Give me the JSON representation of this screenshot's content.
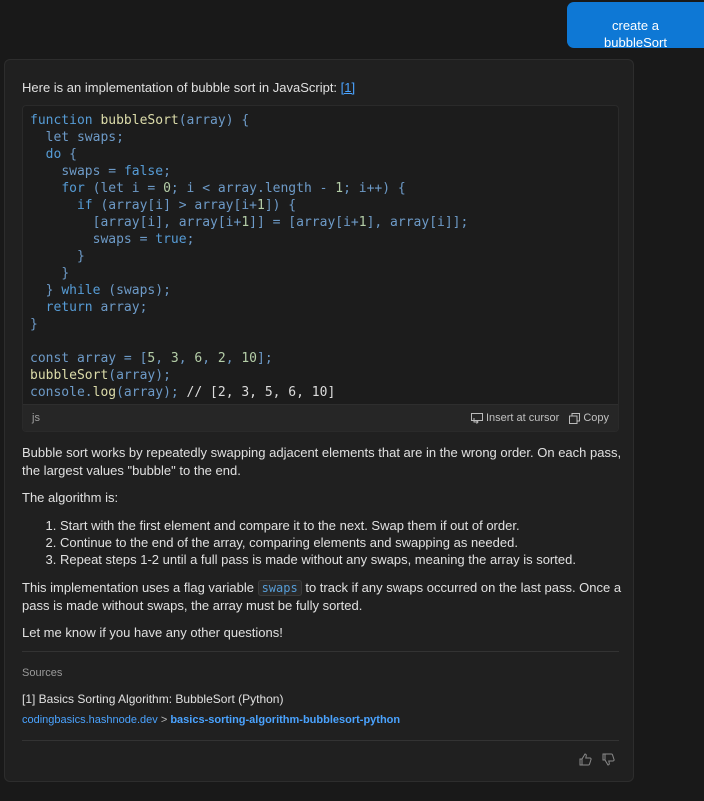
{
  "user_message": "create a bubbleSort",
  "reply": {
    "intro_text": "Here is an implementation of bubble sort in JavaScript:",
    "intro_ref": "[1]",
    "code_language": "js",
    "insert_label": "Insert at cursor",
    "copy_label": "Copy",
    "para1": "Bubble sort works by repeatedly swapping adjacent elements that are in the wrong order. On each pass, the largest values \"bubble\" to the end.",
    "para2": "The algorithm is:",
    "steps": [
      "Start with the first element and compare it to the next. Swap them if out of order.",
      "Continue to the end of the array, comparing elements and swapping as needed.",
      "Repeat steps 1-2 until a full pass is made without any swaps, meaning the array is sorted."
    ],
    "para3_before": "This implementation uses a flag variable",
    "para3_code": "swaps",
    "para3_after": "to track if any swaps occurred on the last pass. Once a pass is made without swaps, the array must be fully sorted.",
    "para4": "Let me know if you have any other questions!",
    "sources_title": "Sources",
    "source_ref": "[1] Basics Sorting Algorithm: BubbleSort (Python)",
    "source_domain": "codingbasics.hashnode.dev",
    "source_separator": ">",
    "source_path": "basics-sorting-algorithm-bubblesort-python"
  },
  "icons": {
    "insert": "insert-at-cursor-icon",
    "copy": "copy-icon",
    "thumbs_up": "thumbs-up-icon",
    "thumbs_down": "thumbs-down-icon"
  },
  "colors": {
    "accent": "#0e78d5",
    "link": "#4aa3ff",
    "keyword": "#569cd6",
    "function": "#dcdcaa",
    "number": "#b5cea8"
  }
}
